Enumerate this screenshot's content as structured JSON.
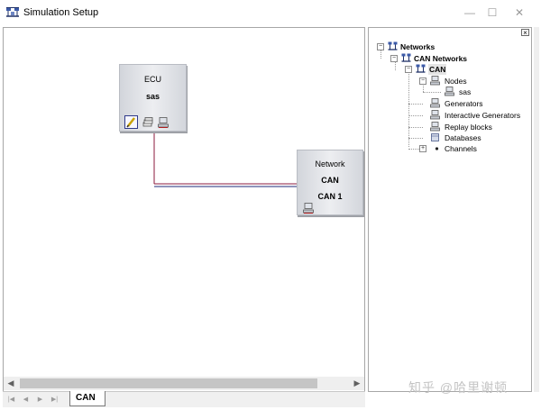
{
  "window": {
    "title": "Simulation Setup",
    "controls": {
      "minimize": "—",
      "maximize": "☐",
      "close": "✕"
    }
  },
  "canvas": {
    "ecu_block": {
      "title": "ECU",
      "name": "sas"
    },
    "network_block": {
      "title": "Network",
      "name": "CAN",
      "channel": "CAN 1"
    },
    "connection_colors": [
      "#8b1a3c",
      "#1f2a7a"
    ]
  },
  "scrollbar": {
    "left_arrow": "◀",
    "right_arrow": "▶"
  },
  "tabs": {
    "nav": [
      "|◀",
      "◀",
      "▶",
      "▶|"
    ],
    "active": "CAN"
  },
  "tree": {
    "close_label": "×",
    "root": "Networks",
    "can_networks": "CAN Networks",
    "can": "CAN",
    "nodes": "Nodes",
    "node_sas": "sas",
    "generators": "Generators",
    "interactive_generators": "Interactive Generators",
    "replay_blocks": "Replay blocks",
    "databases": "Databases",
    "channels": "Channels",
    "expander_open": "−",
    "expander_closed": "+"
  },
  "watermark": "知乎 @哈里谢顿"
}
